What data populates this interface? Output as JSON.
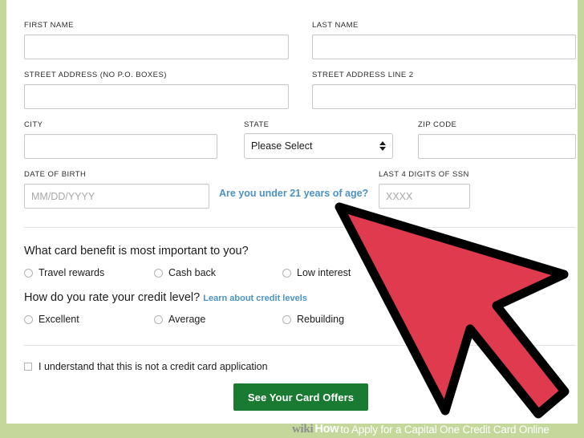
{
  "colors": {
    "frame_green": "#c3d89a",
    "card_white": "#ffffff",
    "link_blue": "#4c93c3",
    "cta_green": "#197a31",
    "cursor_red": "#e03a4e",
    "field_border": "#c9c9c9",
    "divider": "#e2e2e2"
  },
  "form": {
    "fields": {
      "first_name": {
        "label": "FIRST NAME",
        "value": "",
        "placeholder": ""
      },
      "last_name": {
        "label": "LAST NAME",
        "value": "",
        "placeholder": ""
      },
      "street_address": {
        "label": "STREET ADDRESS",
        "label_note": "(NO P.O. BOXES)",
        "value": "",
        "placeholder": ""
      },
      "street_address_2": {
        "label": "STREET ADDRESS LINE 2",
        "value": "",
        "placeholder": ""
      },
      "city": {
        "label": "CITY",
        "value": "",
        "placeholder": ""
      },
      "state": {
        "label": "STATE",
        "selected": "Please Select",
        "options": [
          "Please Select"
        ]
      },
      "zip_code": {
        "label": "ZIP CODE",
        "value": "",
        "placeholder": ""
      },
      "date_of_birth": {
        "label": "DATE OF BIRTH",
        "value": "",
        "placeholder": "MM/DD/YYYY"
      },
      "ssn_last4": {
        "label": "LAST 4 DIGITS OF SSN",
        "value": "",
        "placeholder": "XXXX"
      }
    },
    "links": {
      "under_21": "Are you under 21 years of age?",
      "credit_levels": "Learn about credit levels"
    },
    "questions": [
      {
        "text": "What card benefit is most important to you?",
        "options": [
          "Travel rewards",
          "Cash back",
          "Low interest"
        ],
        "selected": null
      },
      {
        "text": "How do you rate your credit level?",
        "options": [
          "Excellent",
          "Average",
          "Rebuilding"
        ],
        "selected": null
      }
    ],
    "disclaimer_checkbox": {
      "label": "I understand that this is not a credit card application",
      "checked": false
    },
    "submit_button": "See Your Card Offers"
  },
  "watermark": {
    "brand_wiki": "wiki",
    "brand_how": "How",
    "title": "to Apply for a Capital One Credit Card Online"
  }
}
